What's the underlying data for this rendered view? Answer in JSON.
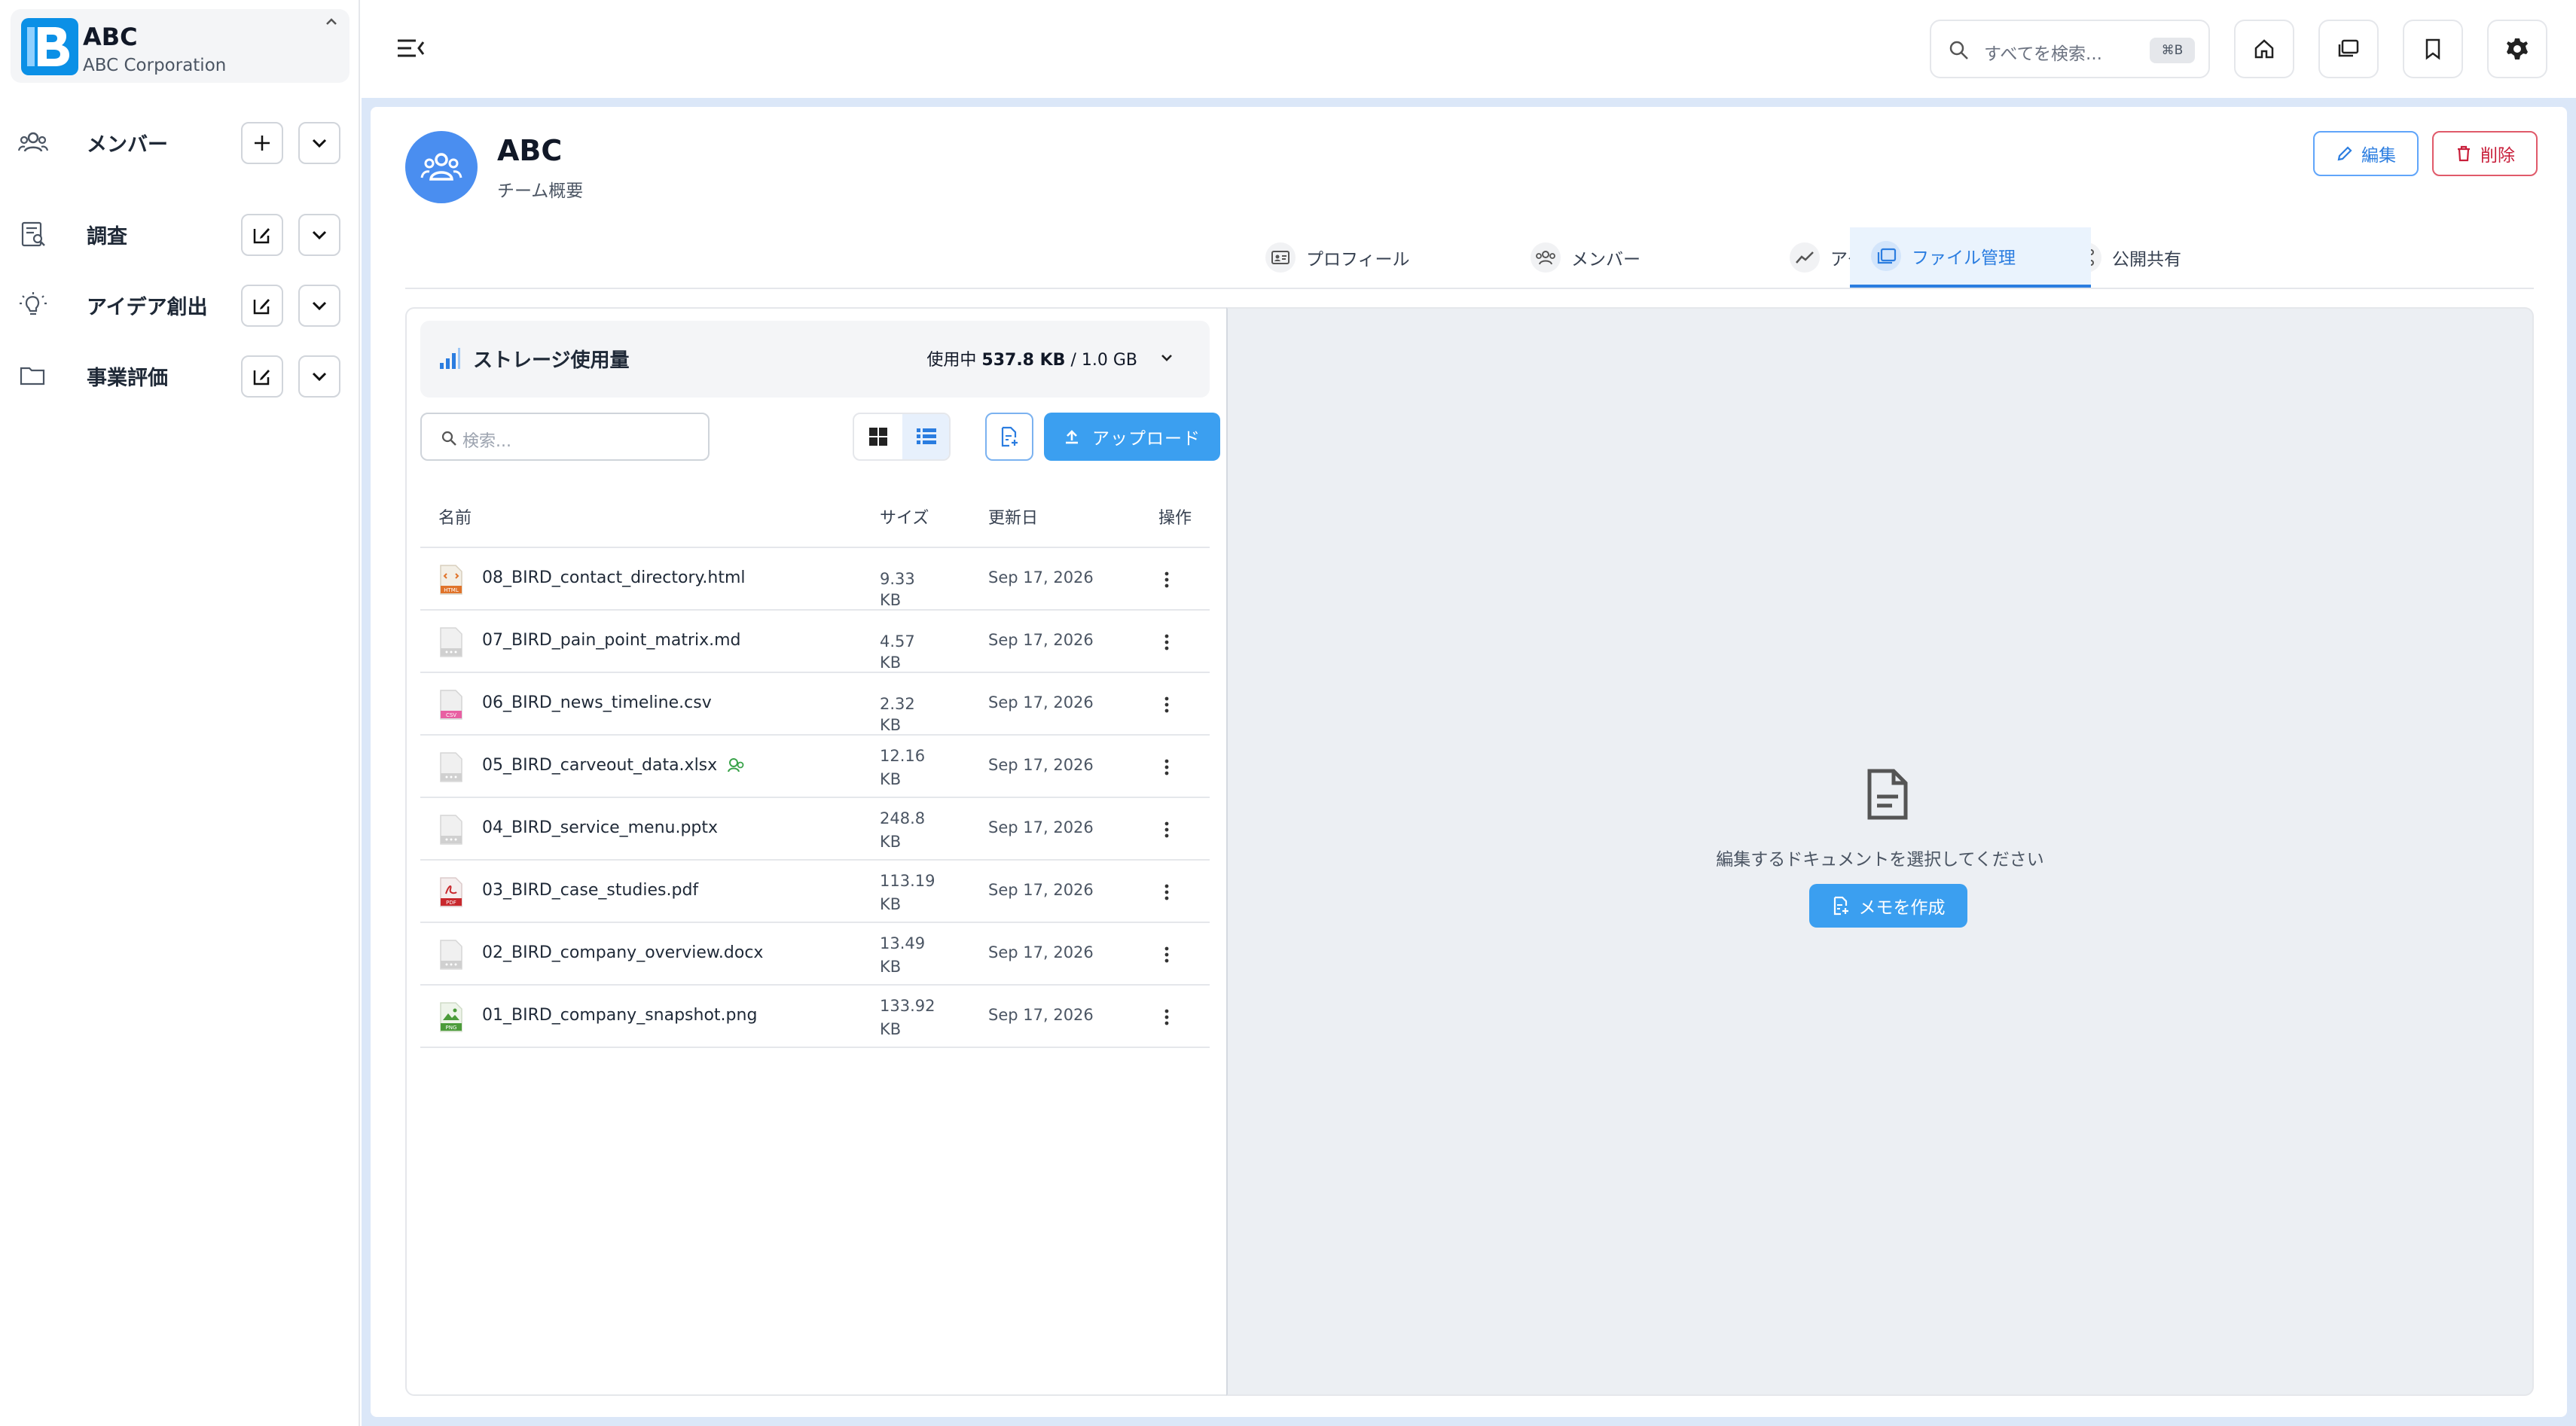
{
  "org": {
    "name": "ABC",
    "subtitle": "ABC Corporation"
  },
  "sidebar": {
    "items": [
      {
        "label": "メンバー",
        "icon": "users-icon",
        "action": "add"
      },
      {
        "label": "調査",
        "icon": "research-icon",
        "action": "edit"
      },
      {
        "label": "アイデア創出",
        "icon": "lightbulb-icon",
        "action": "edit"
      },
      {
        "label": "事業評価",
        "icon": "folder-icon",
        "action": "edit"
      }
    ]
  },
  "topbar": {
    "search_placeholder": "すべてを検索...",
    "search_shortcut": "⌘B"
  },
  "team": {
    "name": "ABC",
    "subtitle": "チーム概要",
    "edit_label": "編集",
    "delete_label": "削除"
  },
  "tabs": [
    {
      "label": "プロフィール",
      "active": false
    },
    {
      "label": "メンバー",
      "active": false
    },
    {
      "label": "アクティビティ",
      "active": false
    },
    {
      "label": "公開共有",
      "active": false
    },
    {
      "label": "ファイル管理",
      "active": true
    }
  ],
  "storage": {
    "title": "ストレージ使用量",
    "prefix": "使用中",
    "used": "537.8 KB",
    "total": "/ 1.0 GB"
  },
  "files": {
    "search_placeholder": "検索...",
    "upload_label": "アップロード",
    "columns": {
      "name": "名前",
      "size": "サイズ",
      "date": "更新日",
      "actions": "操作"
    },
    "rows": [
      {
        "name": "08_BIRD_contact_directory.html",
        "size": "9.33 KB",
        "date": "Sep 17, 2026",
        "type": "html"
      },
      {
        "name": "07_BIRD_pain_point_matrix.md",
        "size": "4.57 KB",
        "date": "Sep 17, 2026",
        "type": "generic"
      },
      {
        "name": "06_BIRD_news_timeline.csv",
        "size": "2.32 KB",
        "date": "Sep 17, 2026",
        "type": "csv"
      },
      {
        "name": "05_BIRD_carveout_data.xlsx",
        "size": "12.16 KB",
        "date": "Sep 17, 2026",
        "type": "generic",
        "badge": true
      },
      {
        "name": "04_BIRD_service_menu.pptx",
        "size": "248.8 KB",
        "date": "Sep 17, 2026",
        "type": "generic"
      },
      {
        "name": "03_BIRD_case_studies.pdf",
        "size": "113.19 KB",
        "date": "Sep 17, 2026",
        "type": "pdf"
      },
      {
        "name": "02_BIRD_company_overview.docx",
        "size": "13.49 KB",
        "date": "Sep 17, 2026",
        "type": "generic"
      },
      {
        "name": "01_BIRD_company_snapshot.png",
        "size": "133.92 KB",
        "date": "Sep 17, 2026",
        "type": "png"
      }
    ]
  },
  "editor": {
    "empty_message": "編集するドキュメントを選択してください",
    "memo_label": "メモを作成"
  },
  "colors": {
    "accent": "#3b9ff0",
    "danger": "#c81e3a",
    "avatar": "#4a8ef0"
  }
}
